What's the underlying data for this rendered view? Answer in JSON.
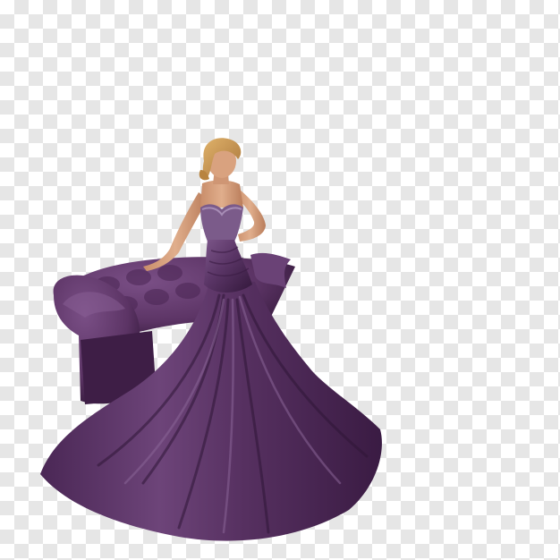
{
  "image": {
    "subject": "woman-in-purple-gown-with-sofa",
    "background": "transparency-checkerboard",
    "colors": {
      "checker_light": "#ffffff",
      "checker_dark": "#e6e6e6",
      "gown_base": "#5a3566",
      "gown_shadow": "#2f1637",
      "gown_highlight": "#8a6597",
      "sofa_base": "#5c3465",
      "sofa_shadow": "#2e1535",
      "skin": "#d9a27f",
      "hair": "#c9974e"
    }
  }
}
